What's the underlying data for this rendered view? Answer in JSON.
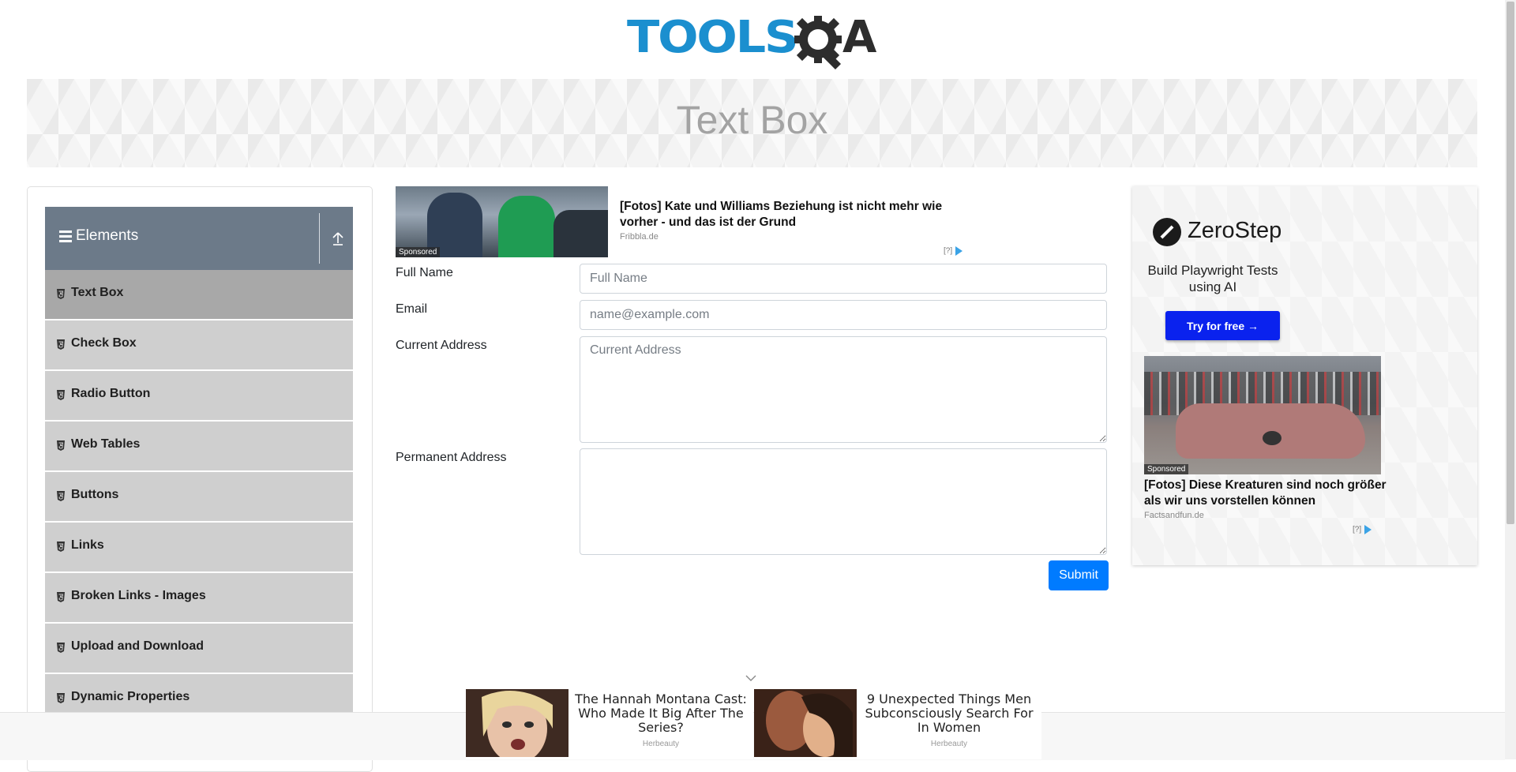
{
  "header": {
    "logo_text": "TOOLSQA",
    "logo_part1": "TOOLS",
    "logo_part2": "A",
    "page_title": "Text Box"
  },
  "sidebar": {
    "group_title": "Elements",
    "items": [
      {
        "label": "Text Box",
        "active": true
      },
      {
        "label": "Check Box"
      },
      {
        "label": "Radio Button"
      },
      {
        "label": "Web Tables"
      },
      {
        "label": "Buttons"
      },
      {
        "label": "Links"
      },
      {
        "label": "Broken Links - Images"
      },
      {
        "label": "Upload and Download"
      },
      {
        "label": "Dynamic Properties"
      }
    ]
  },
  "top_ad": {
    "sponsored": "Sponsored",
    "title": "[Fotos] Kate und Williams Beziehung ist nicht mehr wie vorher - und das ist der Grund",
    "source": "Fribbla.de",
    "choice": "[?]"
  },
  "form": {
    "full_name": {
      "label": "Full Name",
      "placeholder": "Full Name",
      "value": ""
    },
    "email": {
      "label": "Email",
      "placeholder": "name@example.com",
      "value": ""
    },
    "current_address": {
      "label": "Current Address",
      "placeholder": "Current Address",
      "value": ""
    },
    "permanent_address": {
      "label": "Permanent Address",
      "placeholder": "",
      "value": ""
    },
    "submit_label": "Submit"
  },
  "right_ad": {
    "brand": "ZeroStep",
    "subtitle": "Build Playwright Tests using AI",
    "cta": "Try for free →",
    "sponsored": "Sponsored",
    "title": "[Fotos] Diese Kreaturen sind noch größer als wir uns vorstellen können",
    "source": "Factsandfun.de",
    "choice": "[?]"
  },
  "bottom_ads": [
    {
      "title": "The Hannah Montana Cast: Who Made It Big After The Series?",
      "source": "Herbeauty"
    },
    {
      "title": "9 Unexpected Things Men Subconsciously Search For In Women",
      "source": "Herbeauty"
    }
  ],
  "colors": {
    "logo_blue": "#1b8fcf",
    "sidebar_header": "#6c7a89",
    "menu_item": "#cfcfcf",
    "menu_item_active": "#a8a8a8",
    "submit": "#007bff",
    "zerostep_button": "#0a22ee"
  }
}
